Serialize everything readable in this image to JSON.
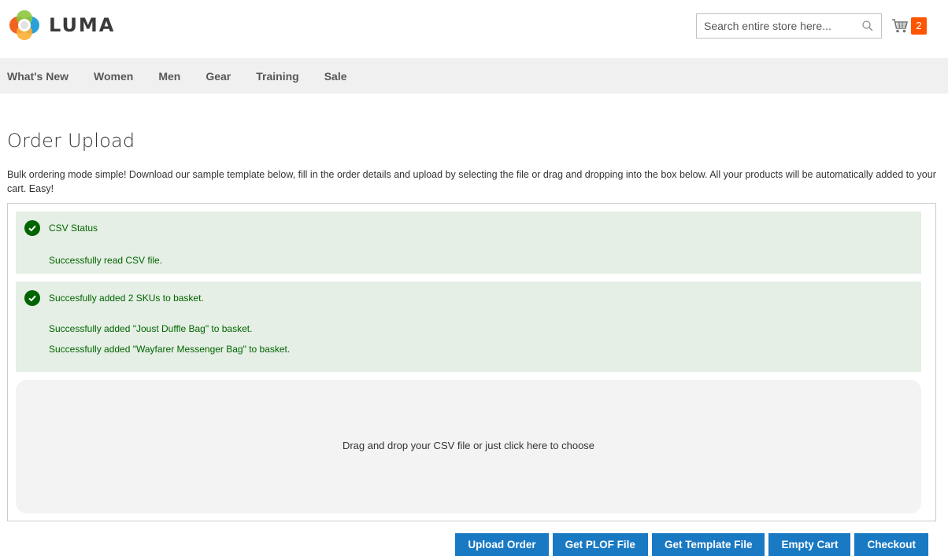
{
  "header": {
    "brand_name": "LUMA",
    "search": {
      "placeholder": "Search entire store here...",
      "value": ""
    },
    "cart": {
      "count": "2"
    }
  },
  "nav": {
    "items": [
      {
        "label": "What's New"
      },
      {
        "label": "Women"
      },
      {
        "label": "Men"
      },
      {
        "label": "Gear"
      },
      {
        "label": "Training"
      },
      {
        "label": "Sale"
      }
    ]
  },
  "main": {
    "title": "Order Upload",
    "intro": "Bulk ordering mode simple! Download our sample template below, fill in the order details and upload by selecting the file or drag and dropping into the box below. All your products will be automatically added to your cart. Easy!",
    "messages": [
      {
        "heading": "CSV Status",
        "lines": [
          "Successfully read CSV file."
        ]
      },
      {
        "heading": "Succesfully added 2 SKUs to basket.",
        "lines": [
          "Successfully added \"Joust Duffle Bag\" to basket.",
          "Successfully added \"Wayfarer Messenger Bag\" to basket."
        ]
      }
    ],
    "dropzone_text": "Drag and drop your CSV file or just click here to choose"
  },
  "actions": {
    "upload_order": "Upload Order",
    "get_plof_file": "Get PLOF File",
    "get_template_file": "Get Template File",
    "empty_cart": "Empty Cart",
    "checkout": "Checkout"
  },
  "colors": {
    "primary_button": "#1979c3",
    "success_bg": "#e5efe5",
    "success_text": "#006400",
    "cart_badge": "#ff5501",
    "nav_bg": "#f0f0f0"
  },
  "icons": {
    "logo": "luma-logo-icon",
    "search": "search-icon",
    "cart": "shopping-cart-icon",
    "success": "check-circle-icon"
  }
}
